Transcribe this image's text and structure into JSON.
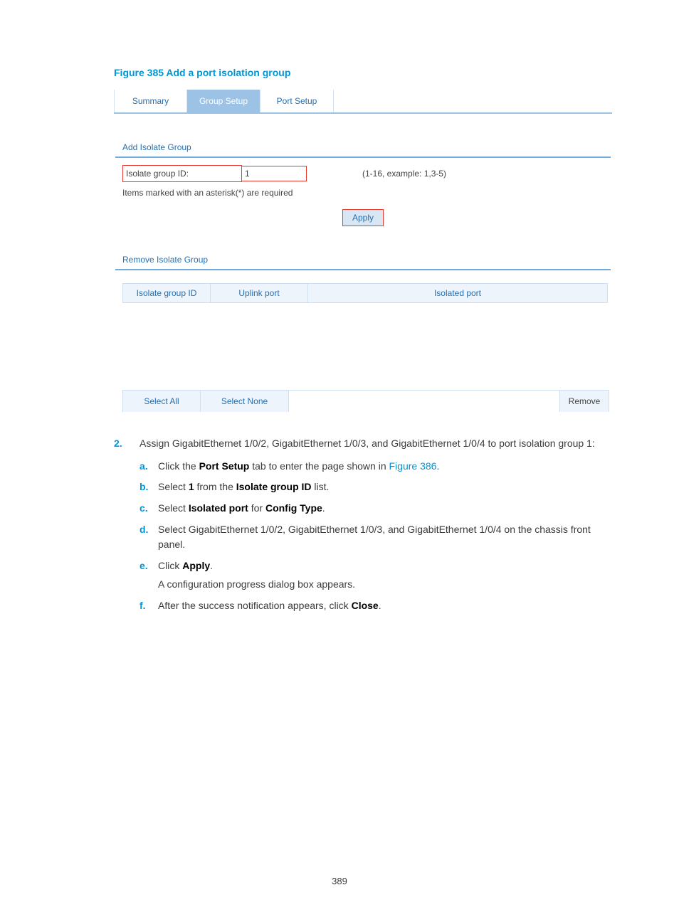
{
  "figure_caption": "Figure 385 Add a port isolation group",
  "screenshot": {
    "tabs": [
      {
        "label": "Summary",
        "active": false
      },
      {
        "label": "Group Setup",
        "active": true
      },
      {
        "label": "Port Setup",
        "active": false
      }
    ],
    "add_section": {
      "title": "Add Isolate Group",
      "field_label": "Isolate group ID:",
      "field_value": "1",
      "hint": "(1-16, example: 1,3-5)",
      "required_note": "Items marked with an asterisk(*) are required",
      "apply_label": "Apply"
    },
    "remove_section": {
      "title": "Remove Isolate Group",
      "columns": [
        "Isolate group ID",
        "Uplink port",
        "Isolated port"
      ],
      "select_all": "Select All",
      "select_none": "Select None",
      "remove": "Remove"
    }
  },
  "step2": {
    "number": "2.",
    "intro": "Assign GigabitEthernet 1/0/2, GigabitEthernet 1/0/3, and GigabitEthernet 1/0/4 to port isolation group 1:",
    "subs": {
      "a": {
        "letter": "a.",
        "pre": "Click the ",
        "b1": "Port Setup",
        "mid": " tab to enter the page shown in ",
        "link": "Figure 386",
        "post": "."
      },
      "b": {
        "letter": "b.",
        "pre": "Select ",
        "b1": "1",
        "mid": " from the ",
        "b2": "Isolate group ID",
        "post": " list."
      },
      "c": {
        "letter": "c.",
        "pre": "Select ",
        "b1": "Isolated port",
        "mid": " for ",
        "b2": "Config Type",
        "post": "."
      },
      "d": {
        "letter": "d.",
        "text": "Select GigabitEthernet 1/0/2, GigabitEthernet 1/0/3, and GigabitEthernet 1/0/4 on the chassis front panel."
      },
      "e": {
        "letter": "e.",
        "pre": "Click ",
        "b1": "Apply",
        "post": ".",
        "note": "A configuration progress dialog box appears."
      },
      "f": {
        "letter": "f.",
        "pre": "After the success notification appears, click ",
        "b1": "Close",
        "post": "."
      }
    }
  },
  "page_number": "389"
}
